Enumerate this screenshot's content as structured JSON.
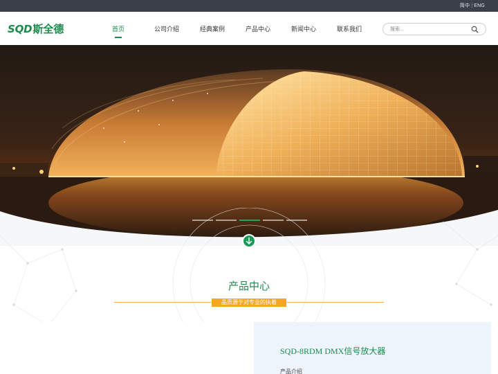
{
  "topbar": {
    "lang_cn": "简中",
    "lang_en": "ENG"
  },
  "brand": {
    "logo_latin": "SQD",
    "logo_cn": "斯全德"
  },
  "nav": {
    "items": [
      {
        "label": "首页",
        "active": true
      },
      {
        "label": "公司介绍",
        "active": false
      },
      {
        "label": "经典案例",
        "active": false
      },
      {
        "label": "产品中心",
        "active": false
      },
      {
        "label": "新闻中心",
        "active": false
      },
      {
        "label": "联系我们",
        "active": false
      }
    ]
  },
  "search": {
    "placeholder": "搜索..."
  },
  "banner": {
    "slides": 5,
    "active_slide": 3
  },
  "section": {
    "title": "产品中心",
    "subtitle": "品质源于对专业的执着"
  },
  "product": {
    "title": "SQD-8RDM DMX信号放大器",
    "subtitle": "产品介绍"
  },
  "colors": {
    "brand_green": "#1b8a4c",
    "accent_orange": "#f5a623",
    "topbar": "#3b3f4a"
  }
}
